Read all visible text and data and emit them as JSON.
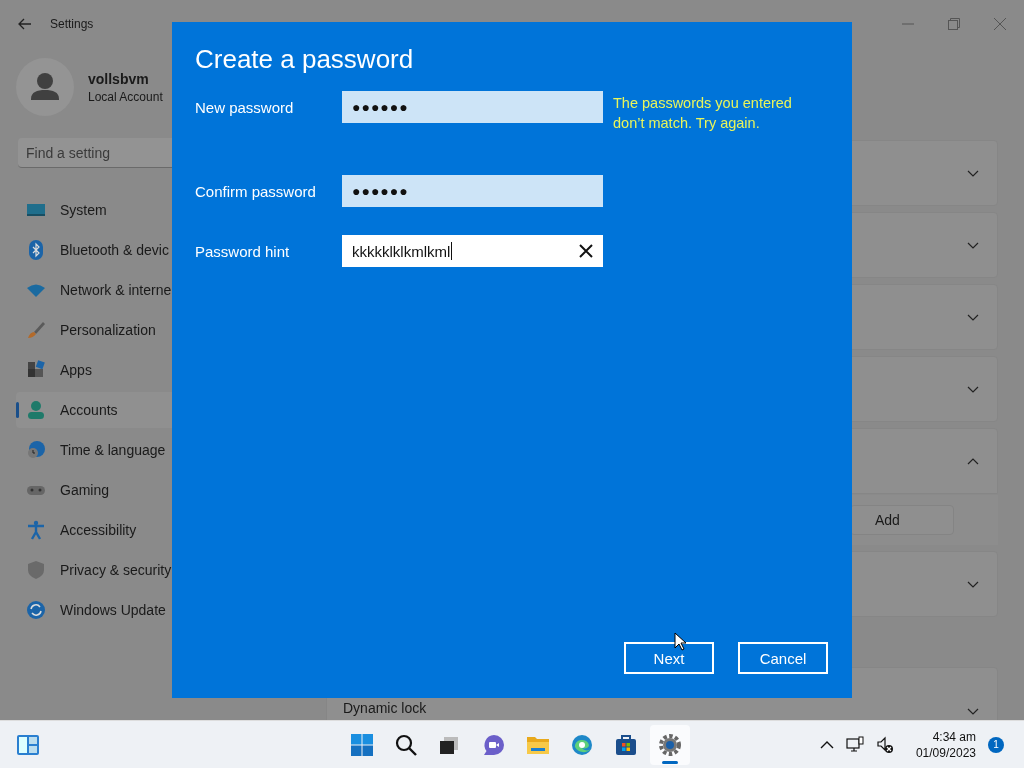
{
  "settings": {
    "title": "Settings",
    "user": {
      "name": "vollsbvm",
      "account_type": "Local Account"
    },
    "search": {
      "placeholder": "Find a setting"
    },
    "nav": [
      {
        "label": "System",
        "selected": false
      },
      {
        "label": "Bluetooth & devic",
        "selected": false
      },
      {
        "label": "Network & interne",
        "selected": false
      },
      {
        "label": "Personalization",
        "selected": false
      },
      {
        "label": "Apps",
        "selected": false
      },
      {
        "label": "Accounts",
        "selected": true
      },
      {
        "label": "Time & language",
        "selected": false
      },
      {
        "label": "Gaming",
        "selected": false
      },
      {
        "label": "Accessibility",
        "selected": false
      },
      {
        "label": "Privacy & security",
        "selected": false
      },
      {
        "label": "Windows Update",
        "selected": false
      }
    ],
    "cards": [
      {
        "expanded": false
      },
      {
        "expanded": false
      },
      {
        "expanded": false
      },
      {
        "expanded": false
      },
      {
        "expanded": true,
        "action": "Add"
      },
      {
        "expanded": false
      }
    ],
    "bottom_card": {
      "title": "Dynamic lock",
      "expanded": false
    }
  },
  "dialog": {
    "title": "Create a password",
    "fields": [
      {
        "label": "New password",
        "kind": "password",
        "value": "●●●●●●"
      },
      {
        "label": "Confirm password",
        "kind": "password",
        "value": "●●●●●●"
      },
      {
        "label": "Password hint",
        "kind": "text",
        "value": "kkkkklklkmlkml"
      }
    ],
    "error": "The passwords you entered don’t match. Try again.",
    "buttons": [
      {
        "label": "Next"
      },
      {
        "label": "Cancel"
      }
    ]
  },
  "taskbar": {
    "apps": [
      {
        "active": false
      },
      {
        "active": false
      },
      {
        "active": false
      },
      {
        "active": false
      },
      {
        "active": false
      },
      {
        "active": false
      },
      {
        "active": false
      },
      {
        "active": true
      }
    ],
    "time": "4:34 am",
    "date": "01/09/2023",
    "notifications": "1"
  }
}
